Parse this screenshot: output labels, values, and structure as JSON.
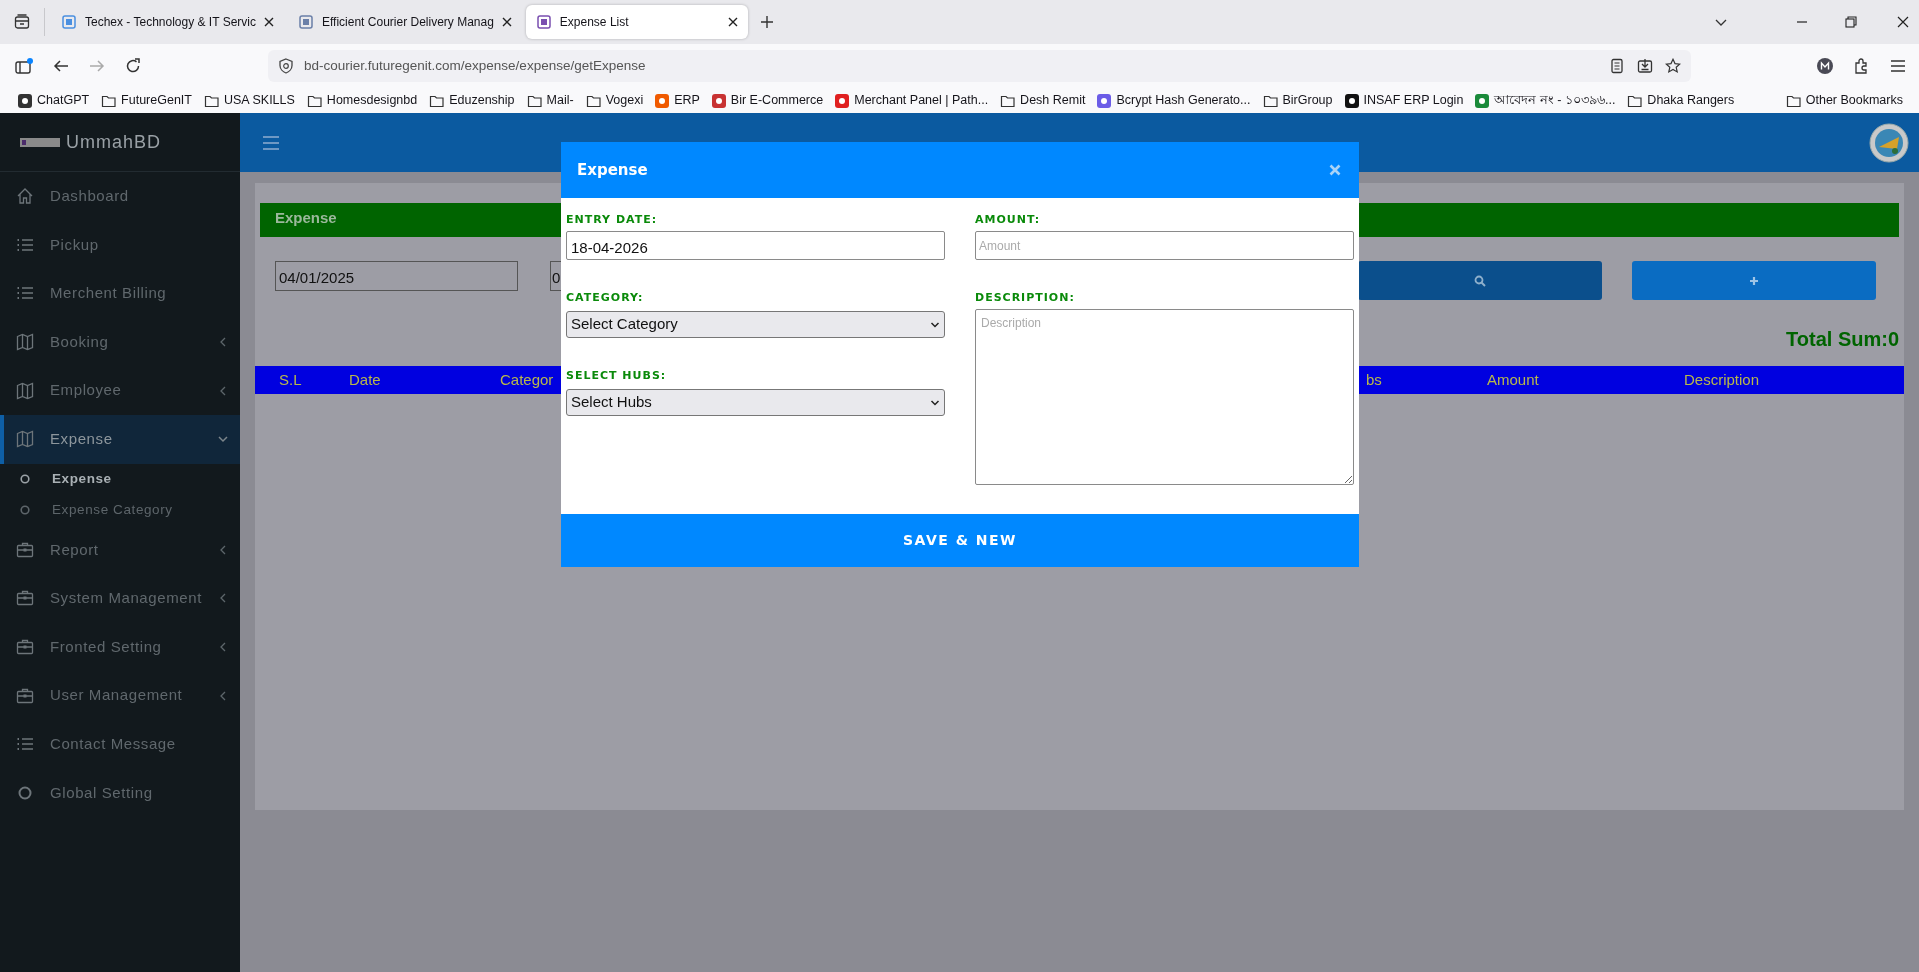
{
  "browser": {
    "tabs": [
      {
        "title": "Techex - Technology & IT Servic",
        "selected": false
      },
      {
        "title": "Efficient Courier Delivery Manag",
        "selected": false
      },
      {
        "title": "Expense List",
        "selected": true
      }
    ],
    "url": "bd-courier.futuregenit.com/expense/expense/getExpense",
    "bookmarks": [
      {
        "label": "ChatGPT",
        "kind": "site",
        "color": "#333333"
      },
      {
        "label": "FutureGenIT",
        "kind": "folder"
      },
      {
        "label": "USA SKILLS",
        "kind": "folder"
      },
      {
        "label": "Homesdesignbd",
        "kind": "folder"
      },
      {
        "label": "Eduzenship",
        "kind": "folder"
      },
      {
        "label": "Mail-",
        "kind": "folder"
      },
      {
        "label": "Vogexi",
        "kind": "folder"
      },
      {
        "label": "ERP",
        "kind": "site",
        "color": "#f05a00"
      },
      {
        "label": "Bir E-Commerce",
        "kind": "site",
        "color": "#c83232"
      },
      {
        "label": "Merchant Panel | Path...",
        "kind": "site",
        "color": "#e02020"
      },
      {
        "label": "Desh Remit",
        "kind": "folder"
      },
      {
        "label": "Bcrypt Hash Generato...",
        "kind": "site",
        "color": "#6b5ce7"
      },
      {
        "label": "BirGroup",
        "kind": "folder"
      },
      {
        "label": "INSAF ERP Login",
        "kind": "site",
        "color": "#111111"
      },
      {
        "label": "আবেদন নং - ১০৩৯৬...",
        "kind": "site",
        "color": "#1a8a3a"
      },
      {
        "label": "Dhaka Rangers",
        "kind": "folder"
      }
    ],
    "other_bookmarks": "Other Bookmarks"
  },
  "sidebar": {
    "brand": "UmmahBD",
    "items": [
      {
        "label": "Dashboard",
        "kind": "home",
        "selected": false
      },
      {
        "label": "Pickup",
        "kind": "list",
        "selected": false
      },
      {
        "label": "Merchent Billing",
        "kind": "list",
        "selected": false
      },
      {
        "label": "Booking",
        "kind": "map",
        "selected": false,
        "expanded": false
      },
      {
        "label": "Employee",
        "kind": "map",
        "selected": false,
        "expanded": false
      },
      {
        "label": "Expense",
        "kind": "map",
        "selected": true,
        "expanded": true,
        "children": [
          {
            "label": "Expense",
            "selected": true
          },
          {
            "label": "Expense Category",
            "selected": false
          }
        ]
      },
      {
        "label": "Report",
        "kind": "briefcase",
        "selected": false,
        "expanded": false
      },
      {
        "label": "System Management",
        "kind": "briefcase",
        "selected": false,
        "expanded": false
      },
      {
        "label": "Fronted Setting",
        "kind": "briefcase",
        "selected": false,
        "expanded": false
      },
      {
        "label": "User Management",
        "kind": "briefcase",
        "selected": false,
        "expanded": false
      },
      {
        "label": "Contact Message",
        "kind": "list",
        "selected": false
      },
      {
        "label": "Global Setting",
        "kind": "circle",
        "selected": false
      }
    ]
  },
  "page": {
    "title": "Expense",
    "from_date": "04/01/2025",
    "to_date": "0",
    "total": "Total Sum:0",
    "columns": [
      "S.L",
      "Date",
      "Categor",
      "bs",
      "Amount",
      "Description"
    ]
  },
  "modal": {
    "title": "Expense",
    "entry_date": {
      "label": "ENTRY DATE:",
      "value": "18-04-2026"
    },
    "amount": {
      "label": "AMOUNT:",
      "placeholder": "Amount"
    },
    "category": {
      "label": "CATEGORY:",
      "value": "Select Category"
    },
    "description": {
      "label": "DESCRIPTION:",
      "placeholder": "Description"
    },
    "hubs": {
      "label": "SELECT HUBS:",
      "value": "Select Hubs"
    },
    "button": "SAVE & NEW"
  }
}
